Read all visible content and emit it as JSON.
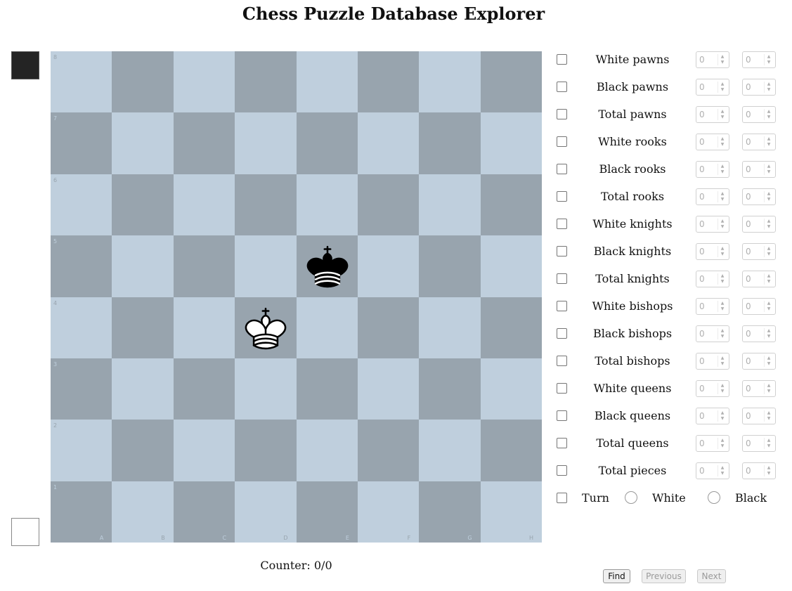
{
  "page": {
    "title": "Chess Puzzle Database Explorer",
    "counter": "Counter: 0/0"
  },
  "board": {
    "files": [
      "A",
      "B",
      "C",
      "D",
      "E",
      "F",
      "G",
      "H"
    ],
    "ranks": [
      "8",
      "7",
      "6",
      "5",
      "4",
      "3",
      "2",
      "1"
    ],
    "light_color": "#bfcfdd",
    "dark_color": "#98a4ae",
    "pieces": [
      {
        "square": "e5",
        "piece": "black-king-icon",
        "glyph": "♚",
        "color": "black"
      },
      {
        "square": "d4",
        "piece": "white-king-icon",
        "glyph": "♔",
        "color": "white"
      }
    ]
  },
  "filters": [
    {
      "label": "White pawns",
      "min": "0",
      "max": "0"
    },
    {
      "label": "Black pawns",
      "min": "0",
      "max": "0"
    },
    {
      "label": "Total pawns",
      "min": "0",
      "max": "0"
    },
    {
      "label": "White rooks",
      "min": "0",
      "max": "0"
    },
    {
      "label": "Black rooks",
      "min": "0",
      "max": "0"
    },
    {
      "label": "Total rooks",
      "min": "0",
      "max": "0"
    },
    {
      "label": "White knights",
      "min": "0",
      "max": "0"
    },
    {
      "label": "Black knights",
      "min": "0",
      "max": "0"
    },
    {
      "label": "Total knights",
      "min": "0",
      "max": "0"
    },
    {
      "label": "White bishops",
      "min": "0",
      "max": "0"
    },
    {
      "label": "Black bishops",
      "min": "0",
      "max": "0"
    },
    {
      "label": "Total bishops",
      "min": "0",
      "max": "0"
    },
    {
      "label": "White queens",
      "min": "0",
      "max": "0"
    },
    {
      "label": "Black queens",
      "min": "0",
      "max": "0"
    },
    {
      "label": "Total queens",
      "min": "0",
      "max": "0"
    },
    {
      "label": "Total pieces",
      "min": "0",
      "max": "0"
    }
  ],
  "turn": {
    "label": "Turn",
    "white_label": "White",
    "black_label": "Black"
  },
  "buttons": {
    "find": "Find",
    "previous": "Previous",
    "next": "Next"
  }
}
